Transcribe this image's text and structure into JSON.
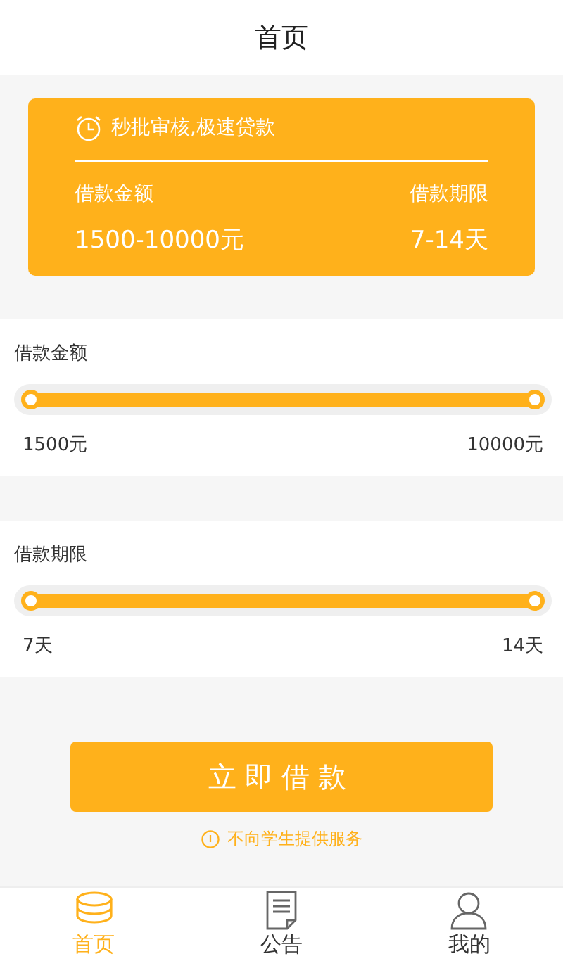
{
  "header": {
    "title": "首页"
  },
  "promo": {
    "slogan": "秒批审核,极速贷款",
    "amount_label": "借款金额",
    "term_label": "借款期限",
    "amount_range": "1500-10000元",
    "term_range": "7-14天"
  },
  "sliders": [
    {
      "label": "借款金额",
      "min": "1500元",
      "max": "10000元"
    },
    {
      "label": "借款期限",
      "min": "7天",
      "max": "14天"
    }
  ],
  "apply_button": "立即借款",
  "notice": "不向学生提供服务",
  "tabs": [
    {
      "kind": "home",
      "label": "首页",
      "selected": true
    },
    {
      "kind": "notice",
      "label": "公告",
      "selected": false
    },
    {
      "kind": "profile",
      "label": "我的",
      "selected": false
    }
  ]
}
